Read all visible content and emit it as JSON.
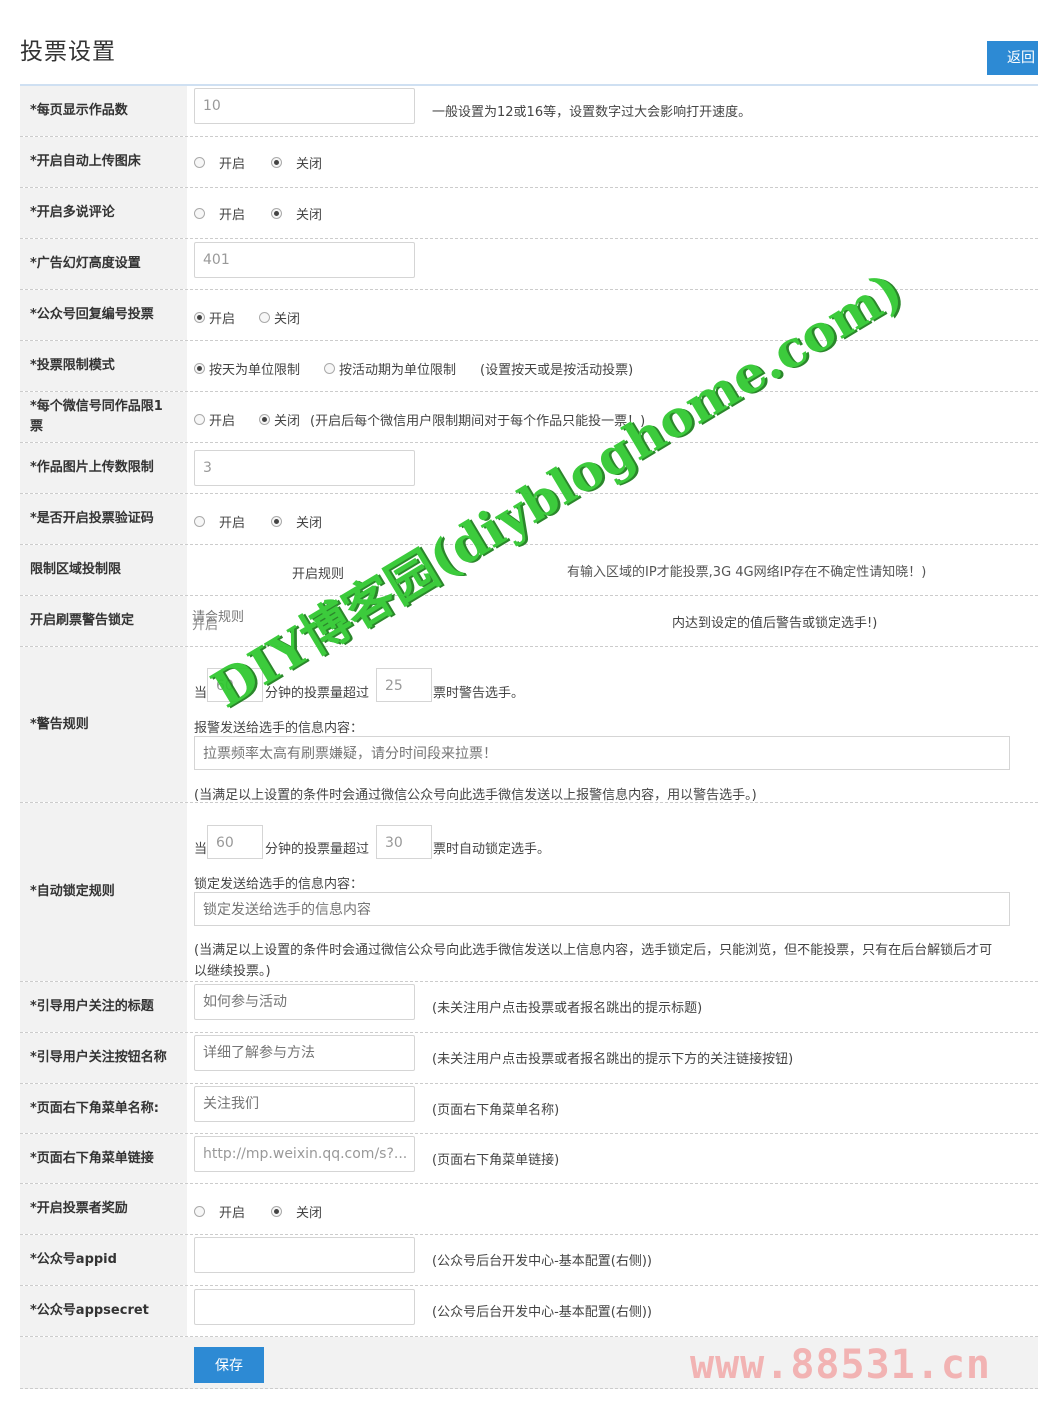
{
  "header": {
    "title": "投票设置",
    "back_label": "返回"
  },
  "rows": {
    "per_page": {
      "label": "*每页显示作品数",
      "value": "10",
      "hint": "一般设置为12或16等，设置数字过大会影响打开速度。"
    },
    "auto_upload": {
      "label": "*开启自动上传图床",
      "on": "开启",
      "off": "关闭",
      "selected": "off"
    },
    "duoshuo": {
      "label": "*开启多说评论",
      "on": "开启",
      "off": "关闭",
      "selected": "off"
    },
    "ad_height": {
      "label": "*广告幻灯高度设置",
      "value": "401"
    },
    "mp_reply": {
      "label": "*公众号回复编号投票",
      "on": "开启",
      "off": "关闭",
      "selected": "on"
    },
    "limit_mode": {
      "label": "*投票限制模式",
      "opt_day": "按天为单位限制",
      "opt_period": "按活动期为单位限制",
      "hint": "(设置按天或是按活动投票)",
      "selected": "day"
    },
    "one_vote": {
      "label": "*每个微信号同作品限1票",
      "on": "开启",
      "off": "关闭",
      "hint": "(开启后每个微信用户限制期间对于每个作品只能投一票！)",
      "selected": "off"
    },
    "upload_limit": {
      "label": "*作品图片上传数限制",
      "value": "3"
    },
    "captcha": {
      "label": "*是否开启投票验证码",
      "on": "开启",
      "off": "关闭",
      "selected": "off"
    },
    "region_limit": {
      "label": "限制区域投制限",
      "center": "开启规则",
      "hint": "有输入区域的IP才能投票,3G 4G网络IP存在不确定性请知晓！)"
    },
    "brush_warn": {
      "label": "开启刷票警告锁定",
      "on": "开启",
      "note": "请会规则",
      "hint": "内达到设定的值后警告或锁定选手!)"
    },
    "warn_rule": {
      "label": "*警告规则",
      "prefix": "当",
      "minutes": "60",
      "middle": "分钟的投票量超过",
      "votes": "25",
      "suffix": "票时警告选手。",
      "msg_label": "报警发送给选手的信息内容：",
      "msg_placeholder": "拉票频率太高有刷票嫌疑，请分时间段来拉票！",
      "note": "(当满足以上设置的条件时会通过微信公众号向此选手微信发送以上报警信息内容，用以警告选手。)"
    },
    "lock_rule": {
      "label": "*自动锁定规则",
      "prefix": "当",
      "minutes": "60",
      "middle": "分钟的投票量超过",
      "votes": "30",
      "suffix": "票时自动锁定选手。",
      "msg_label": "锁定发送给选手的信息内容：",
      "msg_placeholder": "锁定发送给选手的信息内容",
      "note1": "(当满足以上设置的条件时会通过微信公众号向此选手微信发送以上信息内容，选手锁定后，只能浏览，但不能投票，只有在后台解锁后才可",
      "note2": "以继续投票。)"
    },
    "follow_title": {
      "label": "*引导用户关注的标题",
      "placeholder": "如何参与活动",
      "hint": "(未关注用户点击投票或者报名跳出的提示标题)"
    },
    "follow_button": {
      "label": "*引导用户关注按钮名称",
      "placeholder": "详细了解参与方法",
      "hint": "(未关注用户点击投票或者报名跳出的提示下方的关注链接按钮)"
    },
    "menu_name": {
      "label": "*页面右下角菜单名称:",
      "placeholder": "关注我们",
      "hint": "(页面右下角菜单名称)"
    },
    "menu_link": {
      "label": "*页面右下角菜单链接",
      "value": "http://mp.weixin.qq.com/s?...",
      "hint": "(页面右下角菜单链接)"
    },
    "voter_reward": {
      "label": "*开启投票者奖励",
      "on": "开启",
      "off": "关闭",
      "selected": "off"
    },
    "appid": {
      "label": "*公众号appid",
      "value": "",
      "hint": "(公众号后台开发中心-基本配置(右侧))"
    },
    "appsecret": {
      "label": "*公众号appsecret",
      "value": "",
      "hint": "(公众号后台开发中心-基本配置(右侧))"
    }
  },
  "footer": {
    "save_label": "保存"
  },
  "watermarks": {
    "main": "DIY博客园(diybloghome.com)",
    "site": "www.88531.cn"
  }
}
